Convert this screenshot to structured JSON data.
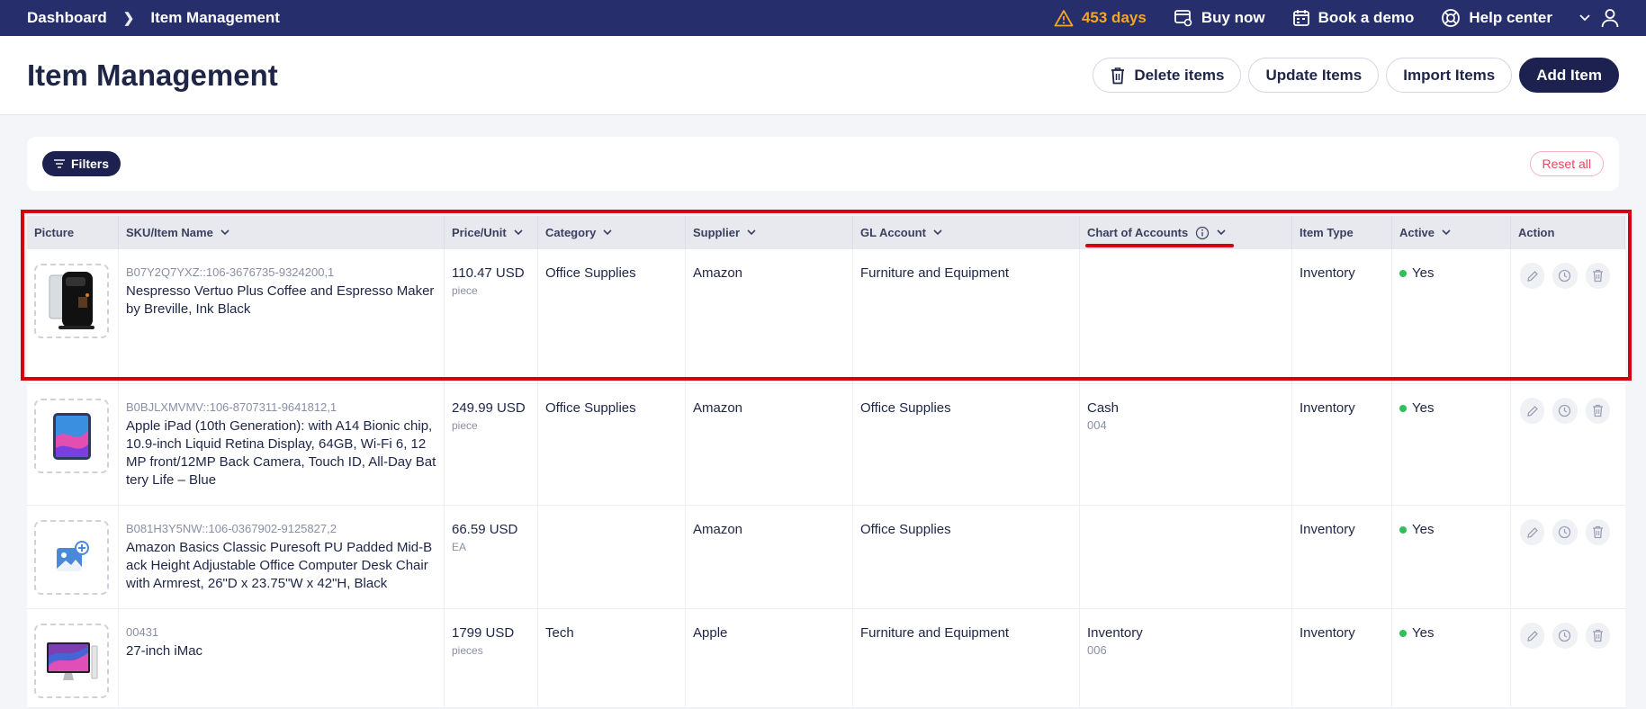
{
  "topbar": {
    "breadcrumb": [
      "Dashboard",
      "Item Management"
    ],
    "trial": "453 days",
    "buy_now": "Buy now",
    "book_demo": "Book a demo",
    "help_center": "Help center"
  },
  "header": {
    "title": "Item Management",
    "delete_items": "Delete items",
    "update_items": "Update Items",
    "import_items": "Import Items",
    "add_item": "Add Item"
  },
  "filters": {
    "label": "Filters",
    "reset": "Reset all"
  },
  "columns": [
    "Picture",
    "SKU/Item Name",
    "Price/Unit",
    "Category",
    "Supplier",
    "GL Account",
    "Chart of Accounts",
    "Item Type",
    "Active",
    "Action"
  ],
  "rows": [
    {
      "sku": "B07Y2Q7YXZ::106-3676735-9324200,1",
      "name": "Nespresso Vertuo Plus Coffee and Espresso Maker by Breville, Ink Black",
      "price": "110.47 USD",
      "unit": "piece",
      "category": "Office Supplies",
      "supplier": "Amazon",
      "gl_account": "Furniture and Equipment",
      "coa": "",
      "coa_code": "",
      "item_type": "Inventory",
      "active": "Yes"
    },
    {
      "sku": "B0BJLXMVMV::106-8707311-9641812,1",
      "name": "Apple iPad (10th Generation): with A14 Bionic chip, 10.9-inch Liquid Retina Display, 64GB, Wi-Fi 6, 12MP front/12MP Back Camera, Touch ID, All-Day Battery Life – Blue",
      "price": "249.99 USD",
      "unit": "piece",
      "category": "Office Supplies",
      "supplier": "Amazon",
      "gl_account": "Office Supplies",
      "coa": "Cash",
      "coa_code": "004",
      "item_type": "Inventory",
      "active": "Yes"
    },
    {
      "sku": "B081H3Y5NW::106-0367902-9125827,2",
      "name": "Amazon Basics Classic Puresoft PU Padded Mid-Back Height Adjustable Office Computer Desk Chair with Armrest, 26\"D x 23.75\"W x 42\"H, Black",
      "price": "66.59 USD",
      "unit": "EA",
      "category": "",
      "supplier": "Amazon",
      "gl_account": "Office Supplies",
      "coa": "",
      "coa_code": "",
      "item_type": "Inventory",
      "active": "Yes"
    },
    {
      "sku": "00431",
      "name": "27-inch iMac",
      "price": "1799 USD",
      "unit": "pieces",
      "category": "Tech",
      "supplier": "Apple",
      "gl_account": "Furniture and Equipment",
      "coa": "Inventory",
      "coa_code": "006",
      "item_type": "Inventory",
      "active": "Yes"
    }
  ],
  "colors": {
    "topbar": "#262f6b",
    "primary": "#1c2150",
    "warning": "#f5a623",
    "highlight": "#d6000d",
    "active_dot": "#2fbf5b"
  }
}
